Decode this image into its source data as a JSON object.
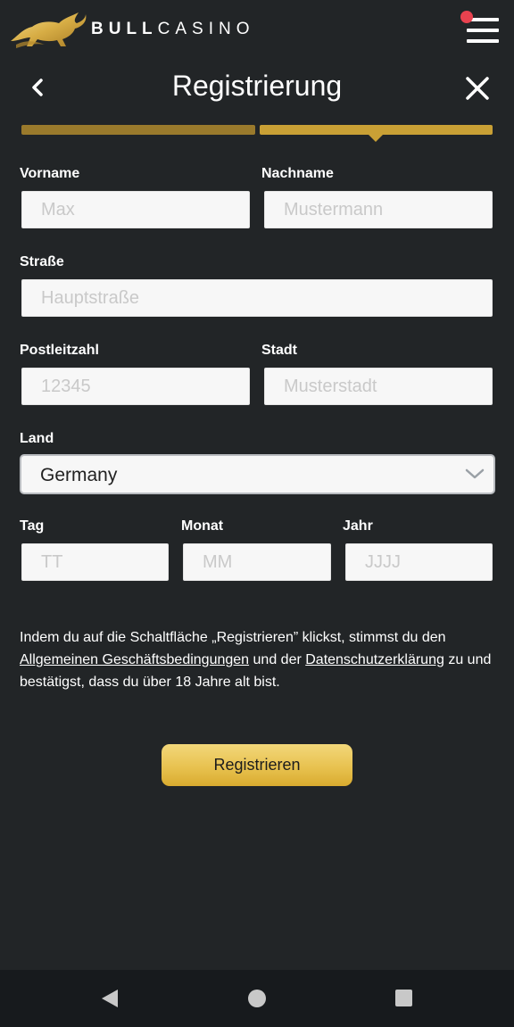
{
  "header": {
    "brand_bold": "BULL",
    "brand_light": "CASINO",
    "menu_icon": "hamburger-menu-icon",
    "notification_color": "#e8424f",
    "logo_icon": "bull-logo-icon"
  },
  "titlebar": {
    "title": "Registrierung",
    "back_icon": "chevron-left-icon",
    "close_icon": "close-icon"
  },
  "progress": {
    "steps_total": 2,
    "current_step": 2,
    "colors": {
      "done": "#9a7a2c",
      "active": "#c9a035"
    }
  },
  "form": {
    "first_name": {
      "label": "Vorname",
      "placeholder": "Max",
      "value": ""
    },
    "last_name": {
      "label": "Nachname",
      "placeholder": "Mustermann",
      "value": ""
    },
    "street": {
      "label": "Straße",
      "placeholder": "Hauptstraße",
      "value": ""
    },
    "postal_code": {
      "label": "Postleitzahl",
      "placeholder": "12345",
      "value": ""
    },
    "city": {
      "label": "Stadt",
      "placeholder": "Musterstadt",
      "value": ""
    },
    "country": {
      "label": "Land",
      "value": "Germany"
    },
    "day": {
      "label": "Tag",
      "placeholder": "TT",
      "value": ""
    },
    "month": {
      "label": "Monat",
      "placeholder": "MM",
      "value": ""
    },
    "year": {
      "label": "Jahr",
      "placeholder": "JJJJ",
      "value": ""
    }
  },
  "terms": {
    "text_before": "Indem du auf die Schaltfläche „Registrieren” klickst, stimmst du den ",
    "link_terms": "Allgemeinen Geschäftsbedingungen",
    "text_middle": " und der ",
    "link_privacy": "Datenschutzerklärung",
    "text_after": " zu und bestätigst, dass du über 18 Jahre alt bist."
  },
  "submit": {
    "label": "Registrieren",
    "color": "#e8c250"
  },
  "system_nav": {
    "back_icon": "nav-back-icon",
    "home_icon": "nav-home-icon",
    "recents_icon": "nav-recents-icon"
  }
}
